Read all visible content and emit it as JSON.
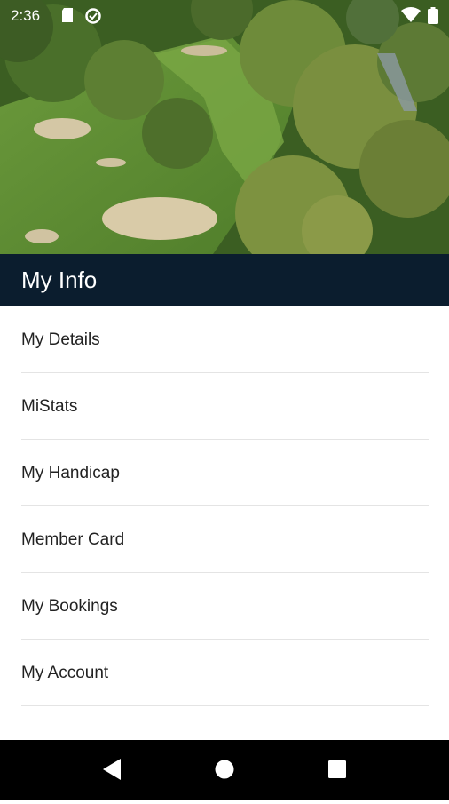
{
  "status_bar": {
    "time": "2:36",
    "icons": [
      "sd-card-icon",
      "data-saver-icon",
      "wifi-icon",
      "battery-icon"
    ]
  },
  "header": {
    "title": "My Info",
    "background_color": "#0b1d2e"
  },
  "menu": {
    "items": [
      {
        "label": "My Details"
      },
      {
        "label": "MiStats"
      },
      {
        "label": "My Handicap"
      },
      {
        "label": "Member Card"
      },
      {
        "label": "My Bookings"
      },
      {
        "label": "My Account"
      }
    ]
  },
  "nav_bar": {
    "buttons": [
      "back-icon",
      "home-icon",
      "recents-icon"
    ]
  }
}
